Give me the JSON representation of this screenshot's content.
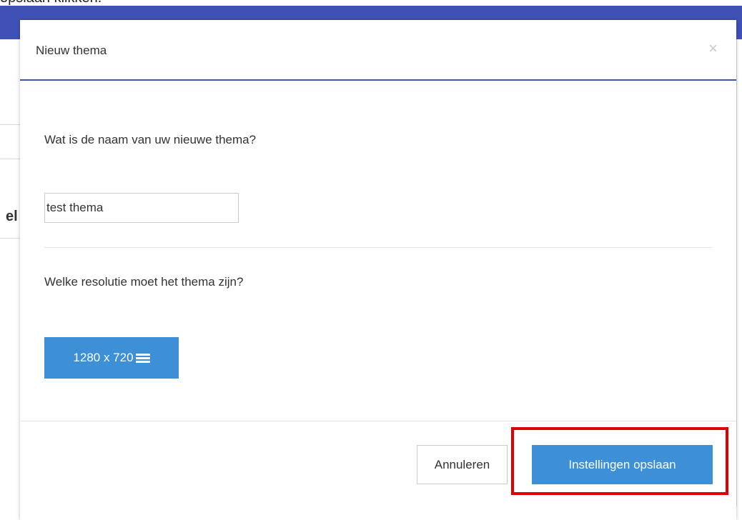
{
  "caption": "opslaan klikken.",
  "background": {
    "fragment": "el"
  },
  "modal": {
    "title": "Nieuw thema",
    "close_glyph": "×",
    "question_name": "Wat is de naam van uw nieuwe thema?",
    "name_input_value": "test thema",
    "question_resolution": "Welke resolutie moet het thema zijn?",
    "resolution_value": "1280 x 720",
    "resolution_icon": "list-icon",
    "cancel_label": "Annuleren",
    "save_label": "Instellingen opslaan"
  },
  "colors": {
    "header_bar": "#3f51b5",
    "primary_button": "#3d8fd6",
    "highlight": "#e00000"
  }
}
